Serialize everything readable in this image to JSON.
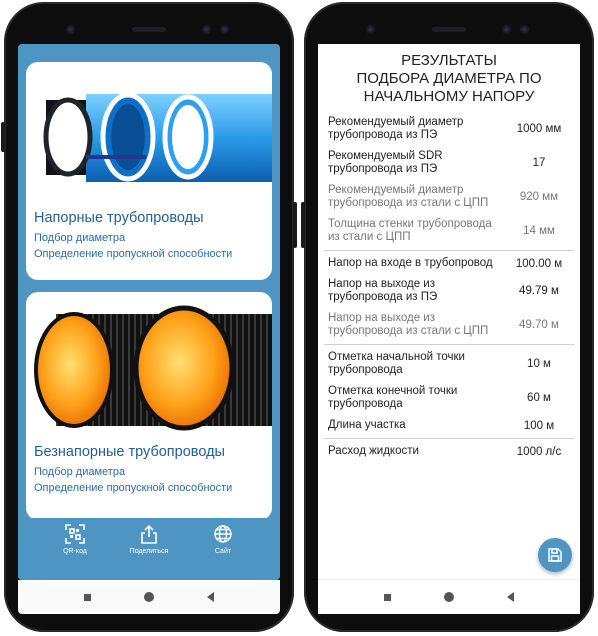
{
  "left_phone": {
    "card1": {
      "title": "Напорные трубопроводы",
      "line1": "Подбор диаметра",
      "line2": "Определение пропускной способности"
    },
    "card2": {
      "title": "Безнапорные трубопроводы",
      "line1": "Подбор диаметра",
      "line2": "Определение пропускной способности"
    },
    "bottom_bar": {
      "qr_label": "QR-код",
      "share_label": "Поделиться",
      "site_label": "Сайт"
    }
  },
  "right_phone": {
    "title_line1": "РЕЗУЛЬТАТЫ",
    "title_line2": "ПОДБОРА ДИАМЕТРА ПО",
    "title_line3": "НАЧАЛЬНОМУ НАПОРУ",
    "rows": [
      {
        "label": "Рекомендуемый диаметр трубопровода из ПЭ",
        "value": "1000 мм"
      },
      {
        "label": "Рекомендуемый SDR трубопровода из ПЭ",
        "value": "17"
      },
      {
        "label": "Рекомендуемый диаметр трубопровода из стали с ЦПП",
        "value": "920 мм"
      },
      {
        "label": "Толщина стенки трубопровода из стали с ЦПП",
        "value": "14 мм"
      },
      {
        "label": "Напор на входе в трубопровод",
        "value": "100.00 м"
      },
      {
        "label": "Напор на выходе из трубопровода из ПЭ",
        "value": "49.79 м"
      },
      {
        "label": "Напор на выходе из трубопровода из стали с ЦПП",
        "value": "49.70 м"
      },
      {
        "label": "Отметка начальной точки трубопровода",
        "value": "10 м"
      },
      {
        "label": "Отметка конечной точки трубопровода",
        "value": "60 м"
      },
      {
        "label": "Длина участка",
        "value": "100 м"
      },
      {
        "label": "Расход жидкости",
        "value": "1000 л/с"
      }
    ]
  },
  "colors": {
    "accent": "#4f95c4",
    "title_blue": "#1f5f9a"
  }
}
